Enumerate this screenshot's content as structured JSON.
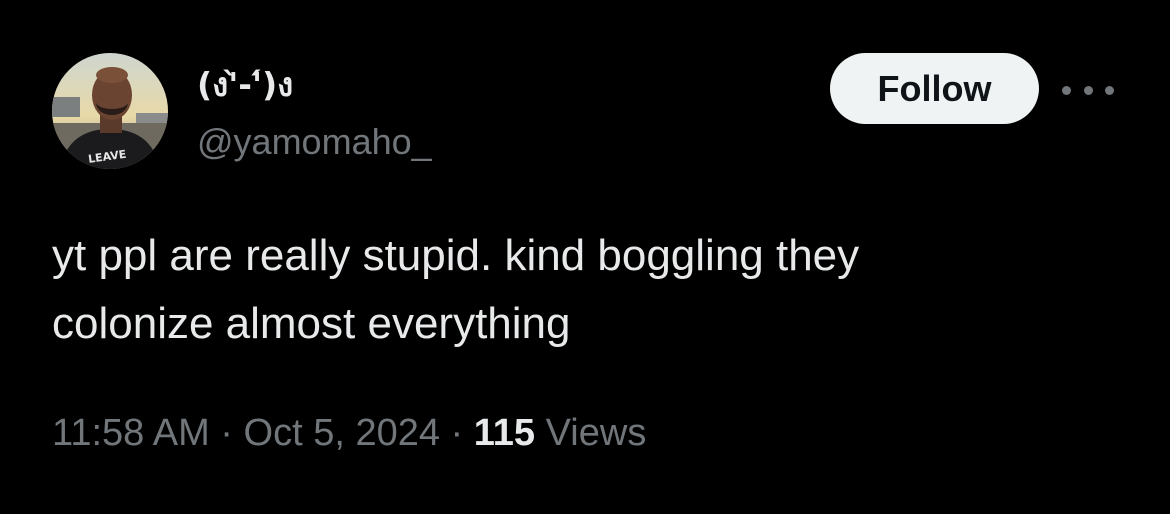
{
  "user": {
    "display_name": "(ง'̀-'́)ง",
    "handle": "@yamomaho_",
    "avatar_shirt_text": "LEAVE"
  },
  "actions": {
    "follow_label": "Follow",
    "more_icon": "more-horizontal-icon"
  },
  "tweet": {
    "line1": "yt ppl are really stupid. kind boggling they",
    "line2": "colonize almost everything"
  },
  "meta": {
    "time": "11:58 AM",
    "separator": "·",
    "date": "Oct 5, 2024",
    "views_count": "115",
    "views_label": "Views"
  },
  "colors": {
    "background": "#000000",
    "primary_text": "#e7e9ea",
    "secondary_text": "#71767b",
    "button_bg": "#eff3f4",
    "button_text": "#0f1419"
  }
}
